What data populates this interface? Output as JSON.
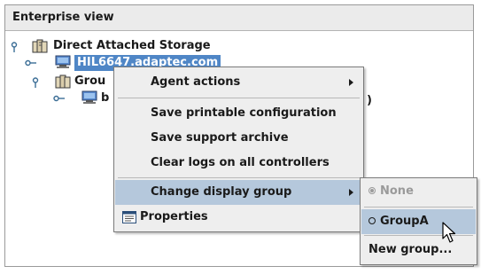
{
  "panel": {
    "title": "Enterprise view"
  },
  "tree": {
    "root_label": "Direct Attached Storage",
    "host_label": "HIL6647.adaptec.com",
    "group_label": "Grou",
    "child_label": "b",
    "child_label_tail": ")"
  },
  "context_menu": {
    "agent_actions": "Agent actions",
    "save_printable_configuration": "Save printable configuration",
    "save_support_archive": "Save support archive",
    "clear_logs": "Clear logs on all controllers",
    "change_display_group": "Change display group",
    "properties": "Properties"
  },
  "submenu": {
    "none": "None",
    "group_a": "GroupA",
    "new_group": "New group..."
  },
  "colors": {
    "selection": "#b5c8dc",
    "host_highlight": "#4f86c6",
    "tree_handle": "#3c6e96"
  }
}
